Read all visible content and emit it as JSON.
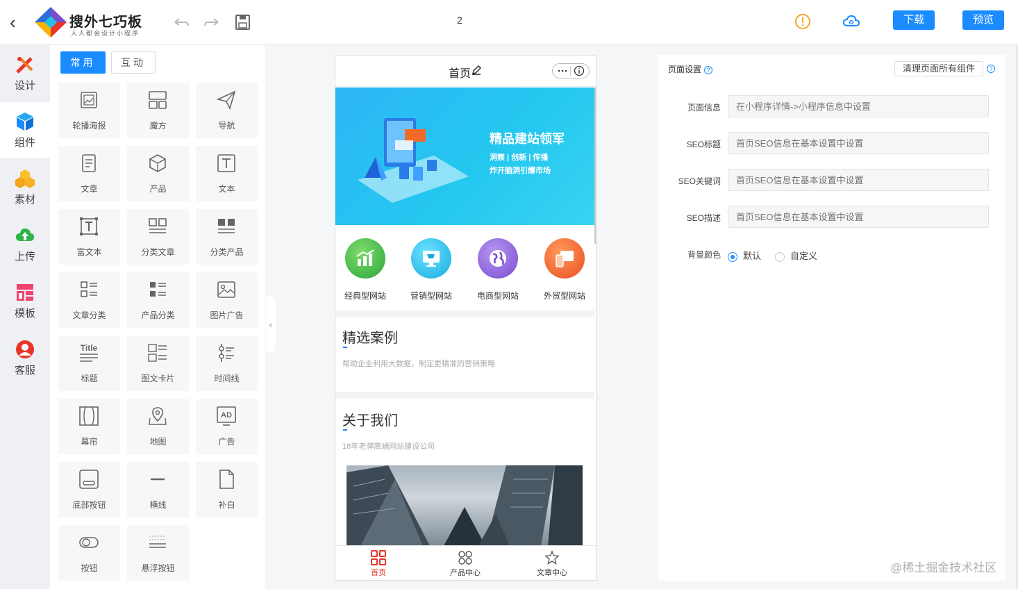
{
  "header": {
    "brand_title": "搜外七巧板",
    "brand_subtitle": "人人都会设计小程序",
    "page_number": "2",
    "download_label": "下载",
    "preview_label": "预览",
    "icons": [
      "back-icon",
      "undo-icon",
      "redo-icon",
      "save-icon",
      "warning-icon",
      "cloud-icon"
    ]
  },
  "leftnav": {
    "items": [
      {
        "label": "设计",
        "icon": "design-icon"
      },
      {
        "label": "组件",
        "icon": "component-icon"
      },
      {
        "label": "素材",
        "icon": "material-icon"
      },
      {
        "label": "上传",
        "icon": "upload-icon"
      },
      {
        "label": "模板",
        "icon": "template-icon"
      },
      {
        "label": "客服",
        "icon": "service-icon"
      }
    ],
    "active": "组件"
  },
  "panel": {
    "tabs": [
      "常用",
      "互动"
    ],
    "components": [
      {
        "label": "轮播海报",
        "icon": "carousel-icon"
      },
      {
        "label": "魔方",
        "icon": "cube-grid-icon"
      },
      {
        "label": "导航",
        "icon": "navigation-icon"
      },
      {
        "label": "文章",
        "icon": "article-icon"
      },
      {
        "label": "产品",
        "icon": "product-icon"
      },
      {
        "label": "文本",
        "icon": "text-icon"
      },
      {
        "label": "富文本",
        "icon": "rich-text-icon"
      },
      {
        "label": "分类文章",
        "icon": "category-article-icon"
      },
      {
        "label": "分类产品",
        "icon": "category-product-icon"
      },
      {
        "label": "文章分类",
        "icon": "article-category-icon"
      },
      {
        "label": "产品分类",
        "icon": "product-category-icon"
      },
      {
        "label": "图片广告",
        "icon": "image-ad-icon"
      },
      {
        "label": "标题",
        "icon": "title-icon"
      },
      {
        "label": "图文卡片",
        "icon": "image-text-card-icon"
      },
      {
        "label": "时间线",
        "icon": "timeline-icon"
      },
      {
        "label": "幕帘",
        "icon": "curtain-icon"
      },
      {
        "label": "地图",
        "icon": "map-icon"
      },
      {
        "label": "广告",
        "icon": "ad-icon"
      },
      {
        "label": "底部按钮",
        "icon": "bottom-button-icon"
      },
      {
        "label": "横线",
        "icon": "horizontal-line-icon"
      },
      {
        "label": "补白",
        "icon": "blank-icon"
      },
      {
        "label": "按钮",
        "icon": "toggle-button-icon"
      },
      {
        "label": "悬浮按钮",
        "icon": "floating-button-icon"
      }
    ],
    "title_icon_text": "Title",
    "ad_icon_text": "AD"
  },
  "phone": {
    "page_title": "首页",
    "banner": {
      "headline": "精品建站领军",
      "line1": "洞察 | 创新 | 传播",
      "line2": "炸开脑洞引爆市场"
    },
    "site_types": [
      {
        "label": "经典型网站",
        "color": "#3fb549"
      },
      {
        "label": "营销型网站",
        "color": "#1fb8e8"
      },
      {
        "label": "电商型网站",
        "color": "#8c5fd8"
      },
      {
        "label": "外贸型网站",
        "color": "#f0562a"
      }
    ],
    "section1": {
      "title": "精选案例",
      "subtitle": "帮助企业利用大数据，制定更精准的营销策略"
    },
    "section2": {
      "title": "关于我们",
      "subtitle": "18年老牌高端网站建设公司"
    },
    "tabbar": [
      {
        "label": "首页",
        "icon": "home-grid-icon"
      },
      {
        "label": "产品中心",
        "icon": "product-center-icon"
      },
      {
        "label": "文章中心",
        "icon": "star-icon"
      }
    ]
  },
  "settings": {
    "title": "页面设置",
    "clear_label": "清理页面所有组件",
    "fields": [
      {
        "label": "页面信息",
        "placeholder": "在小程序详情->小程序信息中设置"
      },
      {
        "label": "SEO标题",
        "placeholder": "首页SEO信息在基本设置中设置"
      },
      {
        "label": "SEO关键词",
        "placeholder": "首页SEO信息在基本设置中设置"
      },
      {
        "label": "SEO描述",
        "placeholder": "首页SEO信息在基本设置中设置"
      }
    ],
    "bg_label": "背景颜色",
    "bg_options": [
      "默认",
      "自定义"
    ],
    "bg_selected": "默认"
  },
  "watermark": "@稀土掘金技术社区",
  "colors": {
    "accent": "#1a8cff",
    "active_tab": "#e8342a"
  }
}
